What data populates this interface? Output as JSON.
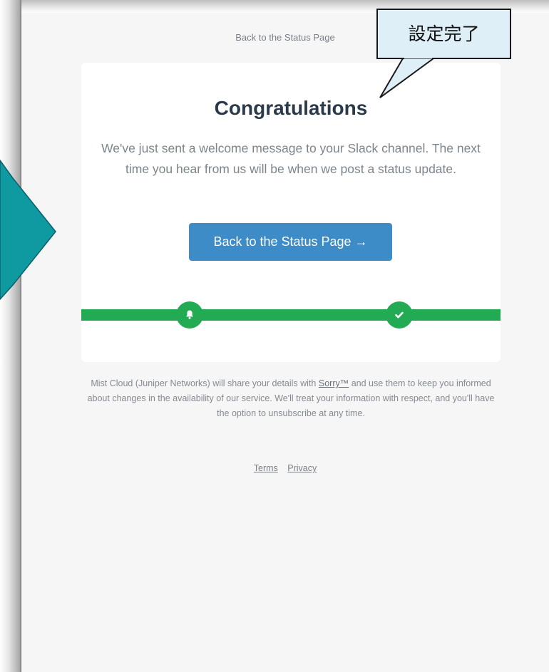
{
  "page": {
    "top_link": "Back to the Status Page"
  },
  "card": {
    "title": "Congratulations",
    "message": "We've just sent a welcome message to your Slack channel. The next time you hear from us will be when we post a status update.",
    "cta_label": "Back to the Status Page →"
  },
  "progress": {
    "steps": [
      {
        "icon": "bell-icon",
        "state": "complete"
      },
      {
        "icon": "check-icon",
        "state": "complete"
      }
    ],
    "color": "#22ab52"
  },
  "disclaimer": {
    "text_before": "Mist Cloud (Juniper Networks) will share your details with ",
    "brand": "Sorry™",
    "text_after": " and use them to keep you informed about changes in the availability of our service. We'll treat your information with respect, and you'll have the option to unsubscribe at any time."
  },
  "footer": {
    "terms": "Terms",
    "privacy": "Privacy"
  },
  "annotation": {
    "callout_text": "設定完了",
    "callout_color": "#dfeff8",
    "arrow_color": "#0e9aa0"
  },
  "colors": {
    "primary_button": "#3d8bc7",
    "title": "#2b3a4a"
  }
}
